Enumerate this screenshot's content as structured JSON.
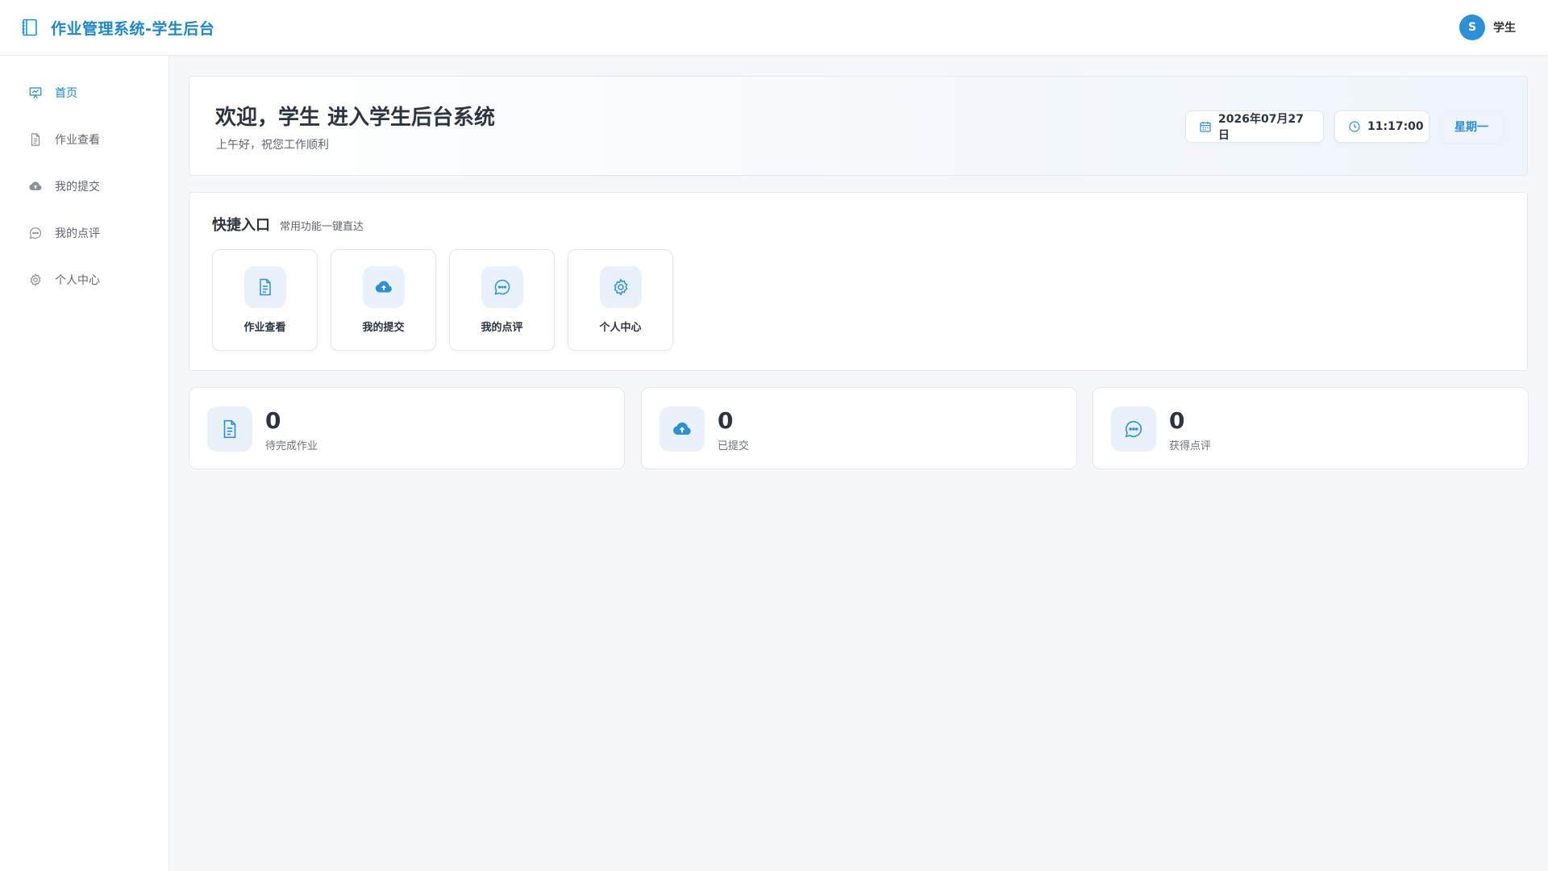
{
  "header": {
    "title": "作业管理系统-学生后台",
    "brand_icon": "notebook-icon",
    "user": {
      "avatar_letter": "S",
      "name": "学生"
    }
  },
  "sidebar": {
    "items": [
      {
        "label": "首页",
        "icon": "presentation-chart-icon",
        "active": true
      },
      {
        "label": "作业查看",
        "icon": "document-icon",
        "active": false
      },
      {
        "label": "我的提交",
        "icon": "cloud-upload-icon",
        "active": false
      },
      {
        "label": "我的点评",
        "icon": "chat-bubble-icon",
        "active": false
      },
      {
        "label": "个人中心",
        "icon": "gear-icon",
        "active": false
      }
    ]
  },
  "welcome": {
    "title": "欢迎，学生 进入学生后台系统",
    "subtitle": "上午好，祝您工作顺利",
    "date": "2026年07月27日",
    "time": "11:17:00",
    "weekday": "星期一"
  },
  "quick": {
    "title": "快捷入口",
    "subtitle": "常用功能一键直达",
    "items": [
      {
        "label": "作业查看",
        "icon": "document-icon"
      },
      {
        "label": "我的提交",
        "icon": "cloud-upload-icon"
      },
      {
        "label": "我的点评",
        "icon": "chat-bubble-icon"
      },
      {
        "label": "个人中心",
        "icon": "gear-icon"
      }
    ]
  },
  "stats": [
    {
      "value": "0",
      "label": "待完成作业",
      "icon": "document-icon"
    },
    {
      "value": "0",
      "label": "已提交",
      "icon": "cloud-upload-icon"
    },
    {
      "value": "0",
      "label": "获得点评",
      "icon": "chat-bubble-icon"
    }
  ],
  "colors": {
    "accent": "#2d8fd6",
    "brand_text": "#1f86c8",
    "icon_bg": "#e9f2fb"
  }
}
